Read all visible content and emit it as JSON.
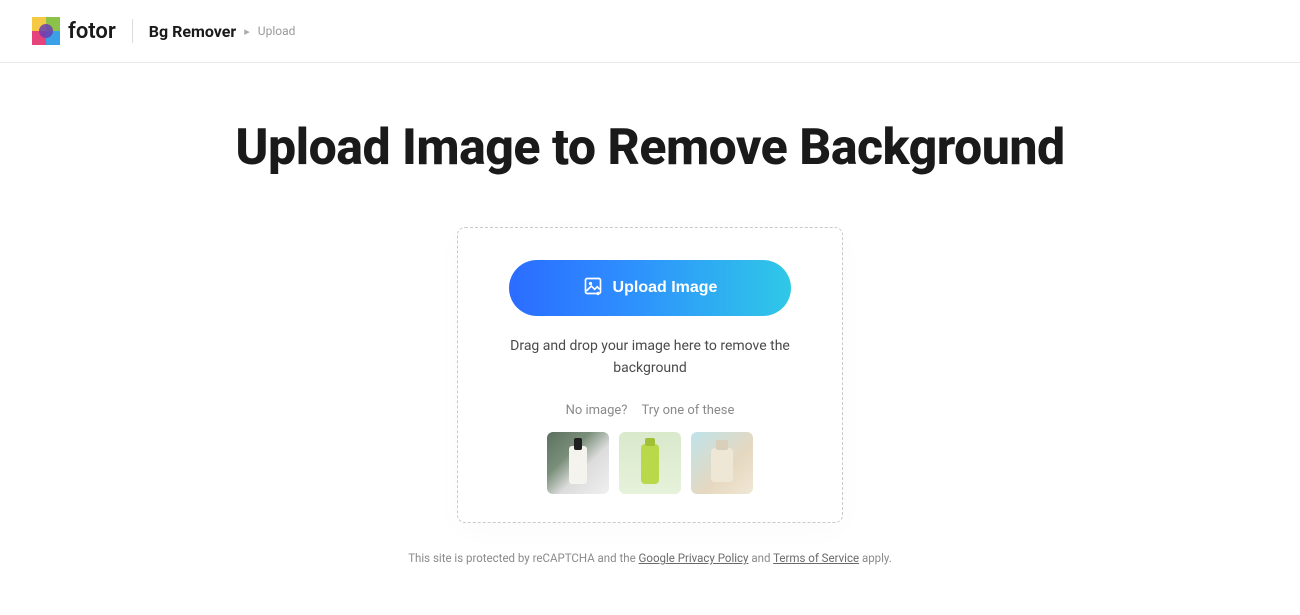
{
  "header": {
    "brand": "fotor",
    "breadcrumb": {
      "section": "Bg Remover",
      "page": "Upload"
    }
  },
  "main": {
    "title": "Upload Image to Remove Background",
    "upload_button": "Upload Image",
    "drop_text": "Drag and drop your image here to remove the background",
    "no_image_label": "No image?",
    "try_label": "Try one of these"
  },
  "footer": {
    "prefix": "This site is protected by reCAPTCHA and the ",
    "privacy_link": "Google Privacy Policy",
    "and": " and ",
    "terms_link": "Terms of Service",
    "suffix": " apply."
  }
}
